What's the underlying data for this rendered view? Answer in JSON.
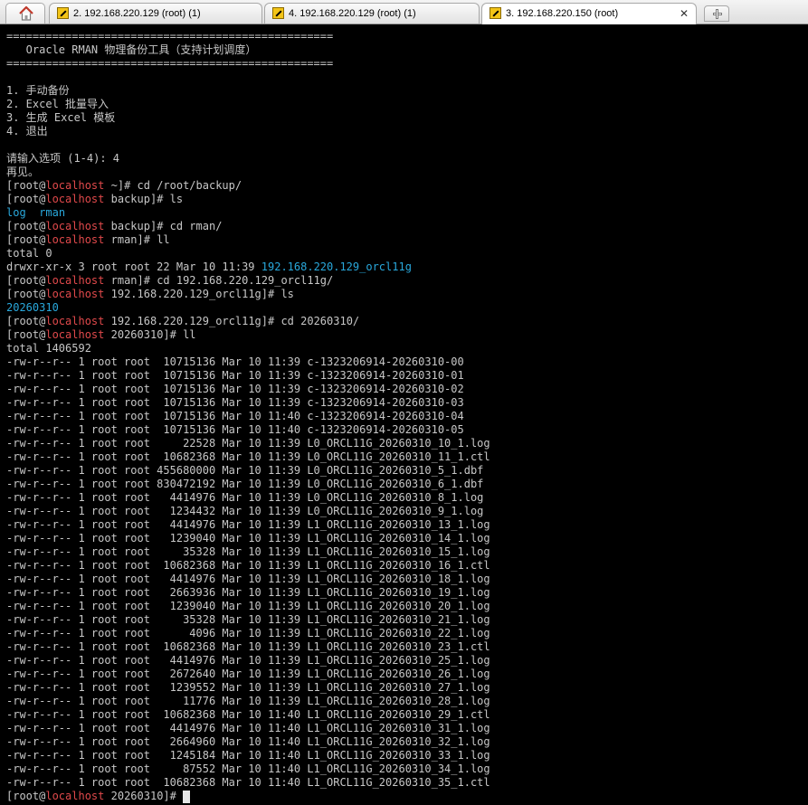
{
  "tabs": [
    {
      "label": "2. 192.168.220.129 (root) (1)",
      "active": false
    },
    {
      "label": "4. 192.168.220.129 (root) (1)",
      "active": false
    },
    {
      "label": "3. 192.168.220.150 (root)",
      "active": true
    }
  ],
  "colors": {
    "background": "#000000",
    "text": "#c7c7c7",
    "host": "#e0494b",
    "directory": "#29a8dc"
  },
  "prompt": {
    "open": "[root@",
    "host": "localhost",
    "suffix_hash": "# "
  },
  "terminal_lines": [
    [
      {
        "t": "=================================================="
      }
    ],
    [
      {
        "t": "   Oracle RMAN 物理备份工具（支持计划调度）"
      }
    ],
    [
      {
        "t": "=================================================="
      }
    ],
    [
      {
        "t": ""
      }
    ],
    [
      {
        "t": "1. 手动备份"
      }
    ],
    [
      {
        "t": "2. Excel 批量导入"
      }
    ],
    [
      {
        "t": "3. 生成 Excel 模板"
      }
    ],
    [
      {
        "t": "4. 退出"
      }
    ],
    [
      {
        "t": ""
      }
    ],
    [
      {
        "t": "请输入选项 (1-4): 4"
      }
    ],
    [
      {
        "t": "再见。"
      }
    ],
    [
      {
        "t": "[root@"
      },
      {
        "t": "localhost",
        "c": "host"
      },
      {
        "t": " ~]# cd /root/backup/"
      }
    ],
    [
      {
        "t": "[root@"
      },
      {
        "t": "localhost",
        "c": "host"
      },
      {
        "t": " backup]# ls"
      }
    ],
    [
      {
        "t": "log",
        "c": "dir"
      },
      {
        "t": "  "
      },
      {
        "t": "rman",
        "c": "dir"
      }
    ],
    [
      {
        "t": "[root@"
      },
      {
        "t": "localhost",
        "c": "host"
      },
      {
        "t": " backup]# cd rman/"
      }
    ],
    [
      {
        "t": "[root@"
      },
      {
        "t": "localhost",
        "c": "host"
      },
      {
        "t": " rman]# ll"
      }
    ],
    [
      {
        "t": "total 0"
      }
    ],
    [
      {
        "t": "drwxr-xr-x 3 root root 22 Mar 10 11:39 "
      },
      {
        "t": "192.168.220.129_orcl11g",
        "c": "dir"
      }
    ],
    [
      {
        "t": "[root@"
      },
      {
        "t": "localhost",
        "c": "host"
      },
      {
        "t": " rman]# cd 192.168.220.129_orcl11g/"
      }
    ],
    [
      {
        "t": "[root@"
      },
      {
        "t": "localhost",
        "c": "host"
      },
      {
        "t": " 192.168.220.129_orcl11g]# ls"
      }
    ],
    [
      {
        "t": "20260310",
        "c": "dir"
      }
    ],
    [
      {
        "t": "[root@"
      },
      {
        "t": "localhost",
        "c": "host"
      },
      {
        "t": " 192.168.220.129_orcl11g]# cd 20260310/"
      }
    ],
    [
      {
        "t": "[root@"
      },
      {
        "t": "localhost",
        "c": "host"
      },
      {
        "t": " 20260310]# ll"
      }
    ],
    [
      {
        "t": "total 1406592"
      }
    ],
    [
      {
        "t": "-rw-r--r-- 1 root root  10715136 Mar 10 11:39 c-1323206914-20260310-00"
      }
    ],
    [
      {
        "t": "-rw-r--r-- 1 root root  10715136 Mar 10 11:39 c-1323206914-20260310-01"
      }
    ],
    [
      {
        "t": "-rw-r--r-- 1 root root  10715136 Mar 10 11:39 c-1323206914-20260310-02"
      }
    ],
    [
      {
        "t": "-rw-r--r-- 1 root root  10715136 Mar 10 11:39 c-1323206914-20260310-03"
      }
    ],
    [
      {
        "t": "-rw-r--r-- 1 root root  10715136 Mar 10 11:40 c-1323206914-20260310-04"
      }
    ],
    [
      {
        "t": "-rw-r--r-- 1 root root  10715136 Mar 10 11:40 c-1323206914-20260310-05"
      }
    ],
    [
      {
        "t": "-rw-r--r-- 1 root root     22528 Mar 10 11:39 L0_ORCL11G_20260310_10_1.log"
      }
    ],
    [
      {
        "t": "-rw-r--r-- 1 root root  10682368 Mar 10 11:39 L0_ORCL11G_20260310_11_1.ctl"
      }
    ],
    [
      {
        "t": "-rw-r--r-- 1 root root 455680000 Mar 10 11:39 L0_ORCL11G_20260310_5_1.dbf"
      }
    ],
    [
      {
        "t": "-rw-r--r-- 1 root root 830472192 Mar 10 11:39 L0_ORCL11G_20260310_6_1.dbf"
      }
    ],
    [
      {
        "t": "-rw-r--r-- 1 root root   4414976 Mar 10 11:39 L0_ORCL11G_20260310_8_1.log"
      }
    ],
    [
      {
        "t": "-rw-r--r-- 1 root root   1234432 Mar 10 11:39 L0_ORCL11G_20260310_9_1.log"
      }
    ],
    [
      {
        "t": "-rw-r--r-- 1 root root   4414976 Mar 10 11:39 L1_ORCL11G_20260310_13_1.log"
      }
    ],
    [
      {
        "t": "-rw-r--r-- 1 root root   1239040 Mar 10 11:39 L1_ORCL11G_20260310_14_1.log"
      }
    ],
    [
      {
        "t": "-rw-r--r-- 1 root root     35328 Mar 10 11:39 L1_ORCL11G_20260310_15_1.log"
      }
    ],
    [
      {
        "t": "-rw-r--r-- 1 root root  10682368 Mar 10 11:39 L1_ORCL11G_20260310_16_1.ctl"
      }
    ],
    [
      {
        "t": "-rw-r--r-- 1 root root   4414976 Mar 10 11:39 L1_ORCL11G_20260310_18_1.log"
      }
    ],
    [
      {
        "t": "-rw-r--r-- 1 root root   2663936 Mar 10 11:39 L1_ORCL11G_20260310_19_1.log"
      }
    ],
    [
      {
        "t": "-rw-r--r-- 1 root root   1239040 Mar 10 11:39 L1_ORCL11G_20260310_20_1.log"
      }
    ],
    [
      {
        "t": "-rw-r--r-- 1 root root     35328 Mar 10 11:39 L1_ORCL11G_20260310_21_1.log"
      }
    ],
    [
      {
        "t": "-rw-r--r-- 1 root root      4096 Mar 10 11:39 L1_ORCL11G_20260310_22_1.log"
      }
    ],
    [
      {
        "t": "-rw-r--r-- 1 root root  10682368 Mar 10 11:39 L1_ORCL11G_20260310_23_1.ctl"
      }
    ],
    [
      {
        "t": "-rw-r--r-- 1 root root   4414976 Mar 10 11:39 L1_ORCL11G_20260310_25_1.log"
      }
    ],
    [
      {
        "t": "-rw-r--r-- 1 root root   2672640 Mar 10 11:39 L1_ORCL11G_20260310_26_1.log"
      }
    ],
    [
      {
        "t": "-rw-r--r-- 1 root root   1239552 Mar 10 11:39 L1_ORCL11G_20260310_27_1.log"
      }
    ],
    [
      {
        "t": "-rw-r--r-- 1 root root     11776 Mar 10 11:39 L1_ORCL11G_20260310_28_1.log"
      }
    ],
    [
      {
        "t": "-rw-r--r-- 1 root root  10682368 Mar 10 11:40 L1_ORCL11G_20260310_29_1.ctl"
      }
    ],
    [
      {
        "t": "-rw-r--r-- 1 root root   4414976 Mar 10 11:40 L1_ORCL11G_20260310_31_1.log"
      }
    ],
    [
      {
        "t": "-rw-r--r-- 1 root root   2664960 Mar 10 11:40 L1_ORCL11G_20260310_32_1.log"
      }
    ],
    [
      {
        "t": "-rw-r--r-- 1 root root   1245184 Mar 10 11:40 L1_ORCL11G_20260310_33_1.log"
      }
    ],
    [
      {
        "t": "-rw-r--r-- 1 root root     87552 Mar 10 11:40 L1_ORCL11G_20260310_34_1.log"
      }
    ],
    [
      {
        "t": "-rw-r--r-- 1 root root  10682368 Mar 10 11:40 L1_ORCL11G_20260310_35_1.ctl"
      }
    ],
    [
      {
        "t": "[root@"
      },
      {
        "t": "localhost",
        "c": "host"
      },
      {
        "t": " 20260310]# "
      },
      {
        "cursor": true
      }
    ]
  ]
}
